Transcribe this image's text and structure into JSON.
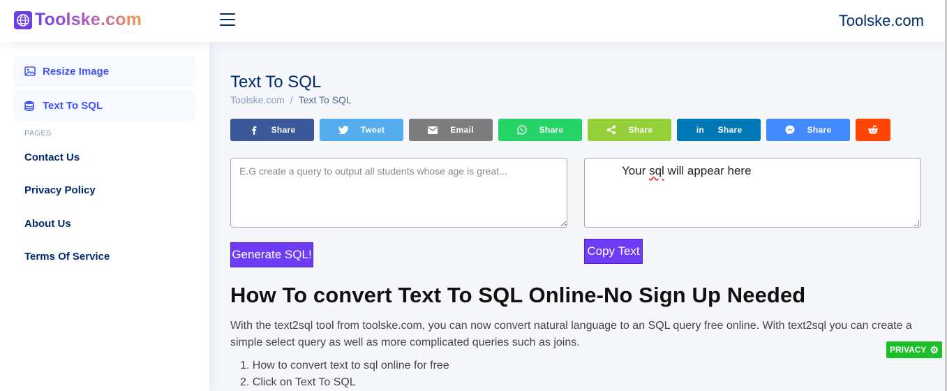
{
  "header": {
    "logo_text": "Toolske.com",
    "brand_right": "Toolske.com"
  },
  "sidebar": {
    "active_items": [
      {
        "label": "Resize Image",
        "icon": "image-icon"
      },
      {
        "label": "Text To SQL",
        "icon": "database-icon"
      }
    ],
    "section_heading": "PAGES",
    "links": [
      "Contact Us",
      "Privacy Policy",
      "About Us",
      "Terms Of Service"
    ]
  },
  "page": {
    "title": "Text To SQL",
    "breadcrumb": {
      "home": "Toolske.com",
      "separator": "/",
      "current": "Text To SQL"
    }
  },
  "share_buttons": [
    {
      "label": "Share",
      "icon": "facebook-icon",
      "color": "#3b5998"
    },
    {
      "label": "Tweet",
      "icon": "twitter-icon",
      "color": "#55acee"
    },
    {
      "label": "Email",
      "icon": "email-icon",
      "color": "#7d7d7d"
    },
    {
      "label": "Share",
      "icon": "whatsapp-icon",
      "color": "#25d366"
    },
    {
      "label": "Share",
      "icon": "sharethis-icon",
      "color": "#95d03a"
    },
    {
      "label": "Share",
      "icon": "linkedin-icon",
      "color": "#0077b5"
    },
    {
      "label": "Share",
      "icon": "messenger-icon",
      "color": "#448aff"
    },
    {
      "label": "",
      "icon": "reddit-icon",
      "color": "#ff4500"
    }
  ],
  "input": {
    "placeholder": "E.G create a query to output all students whose age is great...",
    "value": ""
  },
  "output": {
    "text_before": "Your ",
    "text_flagged": "sql",
    "text_after": " will appear here"
  },
  "buttons": {
    "generate": "Generate SQL!",
    "copy": "Copy Text"
  },
  "article": {
    "heading": "How To convert Text To SQL Online-No Sign Up Needed",
    "paragraph": "With the text2sql tool from toolske.com, you can now convert natural language to an SQL query free online. With text2sql you can create a simple select query as well as more complicated queries such as joins.",
    "steps": [
      "1. How to convert text to sql online for free",
      "2. Click on Text To SQL"
    ]
  },
  "privacy_badge": "PRIVACY",
  "colors": {
    "primary_navy": "#012970",
    "accent_blue": "#4154f1",
    "button_purple": "#6f3cf5",
    "privacy_green": "#1bbf2a"
  }
}
